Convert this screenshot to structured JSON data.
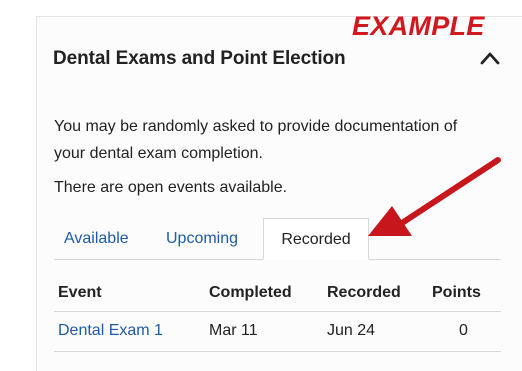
{
  "watermark": "EXAMPLE",
  "panel": {
    "title": "Dental Exams and Point Election",
    "collapse_icon": "chevron-up-icon",
    "description": "You may be randomly asked to provide documentation of your dental exam completion.",
    "open_events_text": "There are open events available."
  },
  "tabs": [
    {
      "label": "Available"
    },
    {
      "label": "Upcoming"
    },
    {
      "label": "Recorded",
      "selected": true
    }
  ],
  "table": {
    "headers": [
      "Event",
      "Completed",
      "Recorded",
      "Points"
    ],
    "rows": [
      {
        "event": "Dental Exam 1",
        "completed": "Mar 11",
        "recorded": "Jun 24",
        "points": "0"
      }
    ]
  },
  "annotation": {
    "arrow_icon": "red-arrow-icon",
    "arrow_color": "#c8161d"
  },
  "colors": {
    "link": "#1f5aa6",
    "watermark": "#d0181e",
    "text": "#222222",
    "border": "#d8d8d8"
  }
}
